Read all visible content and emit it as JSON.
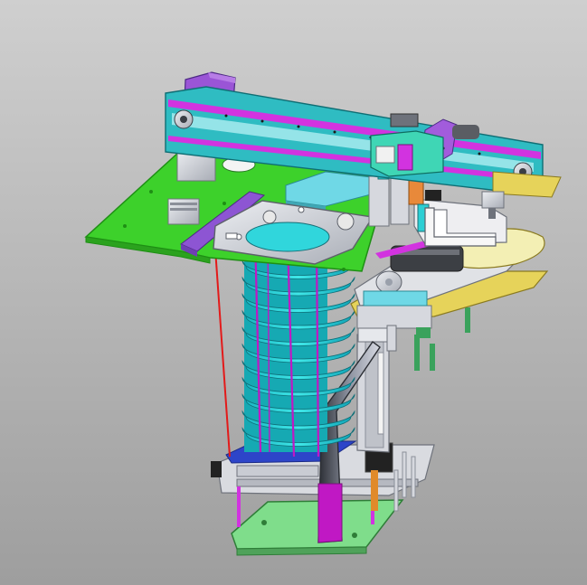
{
  "viewport": {
    "background": {
      "top": "#cfcfcf",
      "bottom": "#9e9e9e"
    }
  },
  "colors": {
    "base_plate": "#3dd12b",
    "base_plate_edge": "#1e8f14",
    "rail_cyan": "#37c9cc",
    "rail_magenta": "#d233e0",
    "motor_purple": "#9a55d6",
    "stack_cyan": "#2ad7db",
    "stack_blue": "#2b3bd8",
    "frame_gray": "#d6d8de",
    "frame_dark": "#8b8f99",
    "blade_light": "#f3efb4",
    "link_red": "#e31a1a",
    "column_green": "#3aa25c",
    "plate_lightgreen": "#7fdd8b",
    "accent_yellow": "#e6d35a",
    "magenta_guide": "#c018c4",
    "foot_black": "#222222"
  },
  "parts": [
    {
      "name": "gantry-rail"
    },
    {
      "name": "motor-block"
    },
    {
      "name": "top-mount-plate"
    },
    {
      "name": "ring-plate"
    },
    {
      "name": "disc-stack"
    },
    {
      "name": "guide-rods"
    },
    {
      "name": "side-linear-unit"
    },
    {
      "name": "roller-unit"
    },
    {
      "name": "curved-blade"
    },
    {
      "name": "lift-column"
    },
    {
      "name": "lift-carriage"
    },
    {
      "name": "base-plate"
    },
    {
      "name": "actuator-arm"
    }
  ]
}
